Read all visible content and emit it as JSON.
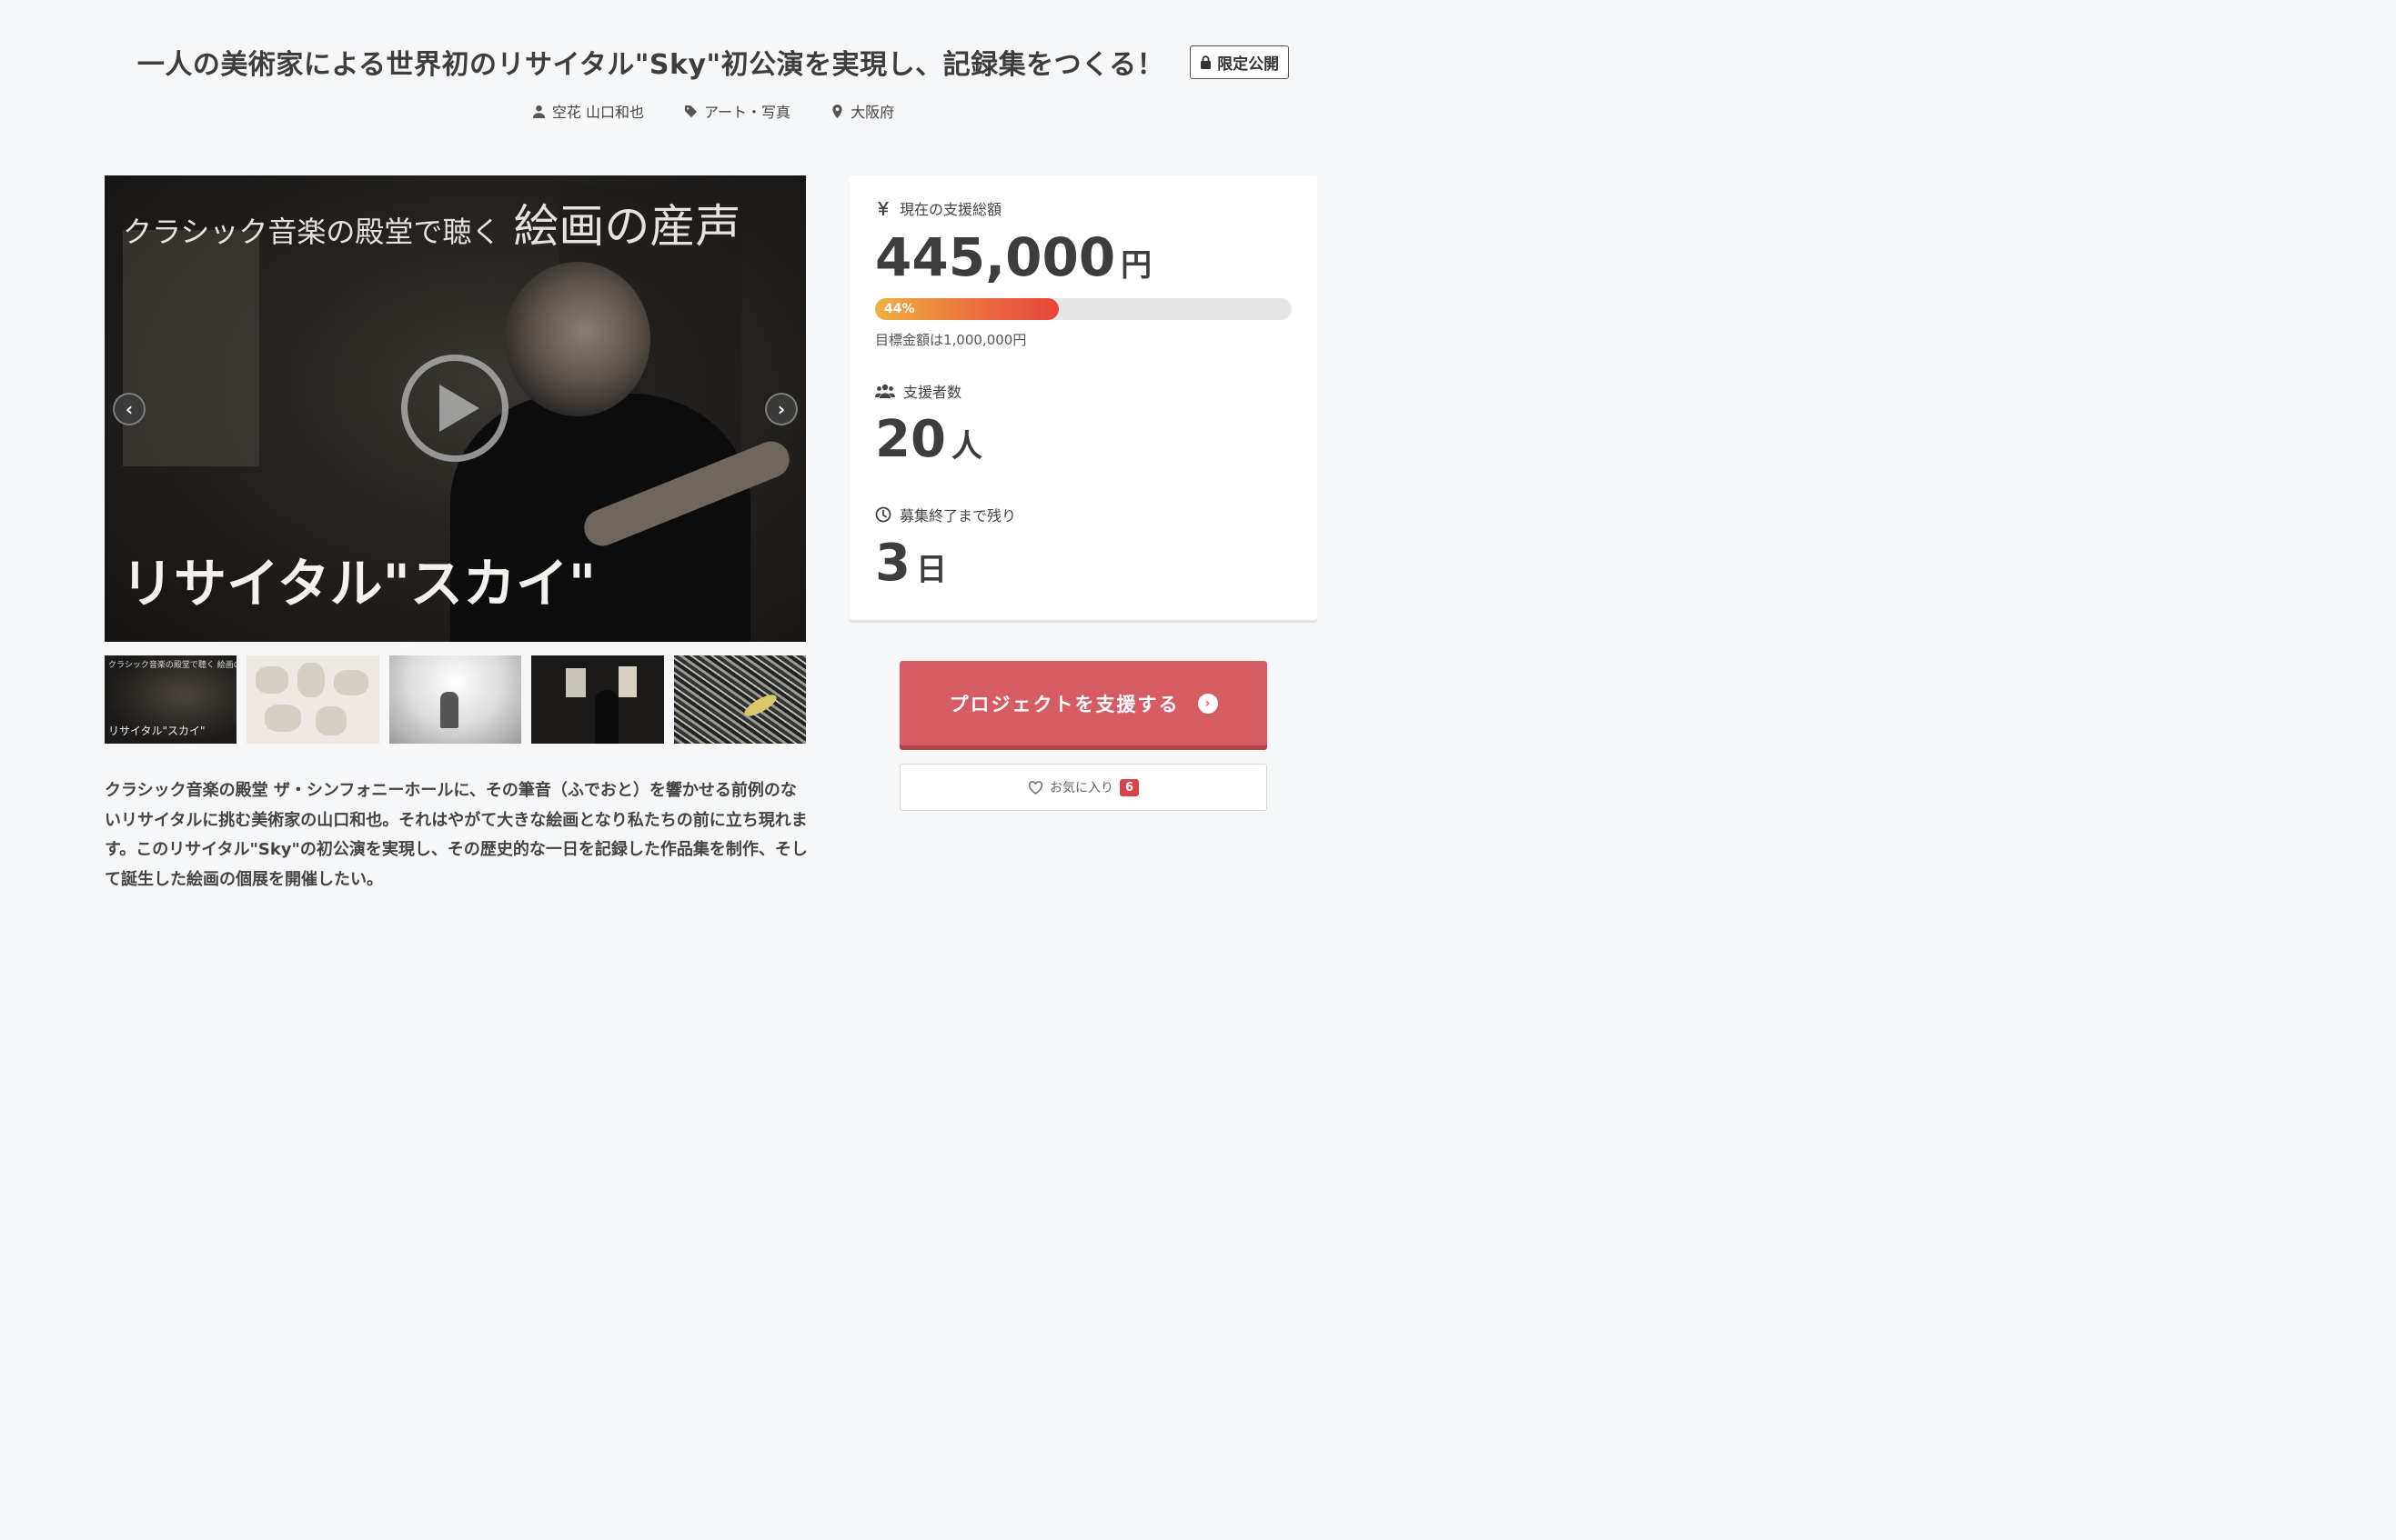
{
  "project": {
    "title": "一人の美術家による世界初のリサイタル\"Sky\"初公演を実現し、記録集をつくる！",
    "badge": "限定公開",
    "owner": "空花 山口和也",
    "category": "アート・写真",
    "location": "大阪府"
  },
  "hero": {
    "top_small": "クラシック音楽の殿堂で聴く",
    "top_big": "絵画の産声",
    "bottom": "リサイタル\"スカイ\"",
    "prev_icon": "chevron-left-icon",
    "next_icon": "chevron-right-icon"
  },
  "thumbnails": {
    "t1_top": "クラシック音楽の殿堂で聴く 絵画の産声",
    "t1_bottom": "リサイタル\"スカイ\""
  },
  "description": "クラシック音楽の殿堂 ザ・シンフォニーホールに、その筆音（ふでおと）を響かせる前例のないリサイタルに挑む美術家の山口和也。それはやがて大きな絵画となり私たちの前に立ち現れます。このリサイタル\"Sky\"の初公演を実現し、その歴史的な一日を記録した作品集を制作、そして誕生した絵画の個展を開催したい。",
  "stats": {
    "amount_label": "現在の支援総額",
    "amount_value": "445,000",
    "amount_unit": "円",
    "progress_text": "44%",
    "progress_fraction": 0.44,
    "goal_text": "目標金額は1,000,000円",
    "supporters_label": "支援者数",
    "supporters_value": "20",
    "supporters_unit": "人",
    "remaining_label": "募集終了まで残り",
    "remaining_value": "3",
    "remaining_unit": "日"
  },
  "actions": {
    "support_label": "プロジェクトを支援する",
    "favorite_label": "お気に入り",
    "favorite_count": "6"
  },
  "colors": {
    "accent": "#d65c63",
    "badge_red": "#d9434b",
    "progress_start": "#f0b040",
    "progress_end": "#e8453e"
  }
}
